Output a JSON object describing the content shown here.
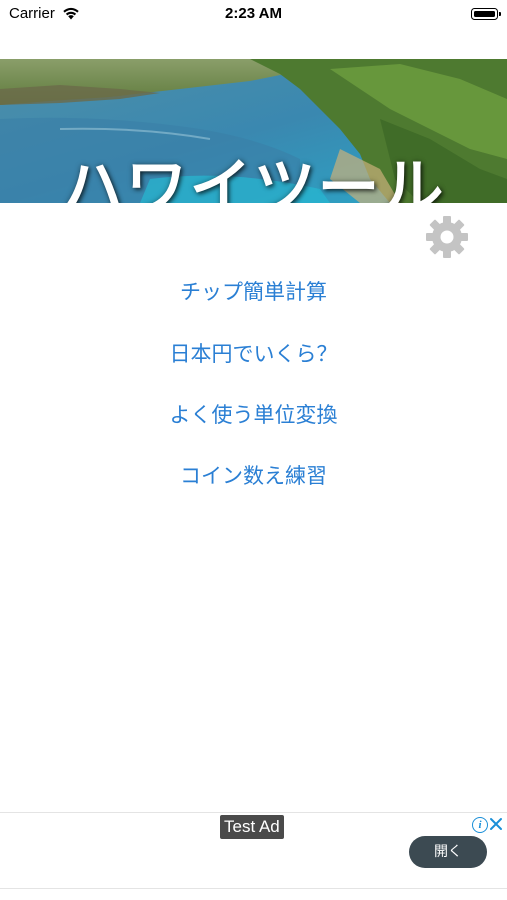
{
  "status_bar": {
    "carrier": "Carrier",
    "time": "2:23 AM"
  },
  "banner": {
    "title": "ハワイツール"
  },
  "settings": {
    "icon": "gear-icon"
  },
  "menu": {
    "items": [
      {
        "label": "チップ簡単計算"
      },
      {
        "label": "日本円でいくら？"
      },
      {
        "label": "よく使う単位変換"
      },
      {
        "label": "コイン数え練習"
      }
    ]
  },
  "ad": {
    "label": "Test Ad",
    "open_label": "開く",
    "info_icon": "info-icon",
    "close_icon": "close-icon"
  },
  "colors": {
    "accent": "#2a7fd4",
    "gear": "#c4c4c4",
    "ad_button": "#3c4a52"
  }
}
